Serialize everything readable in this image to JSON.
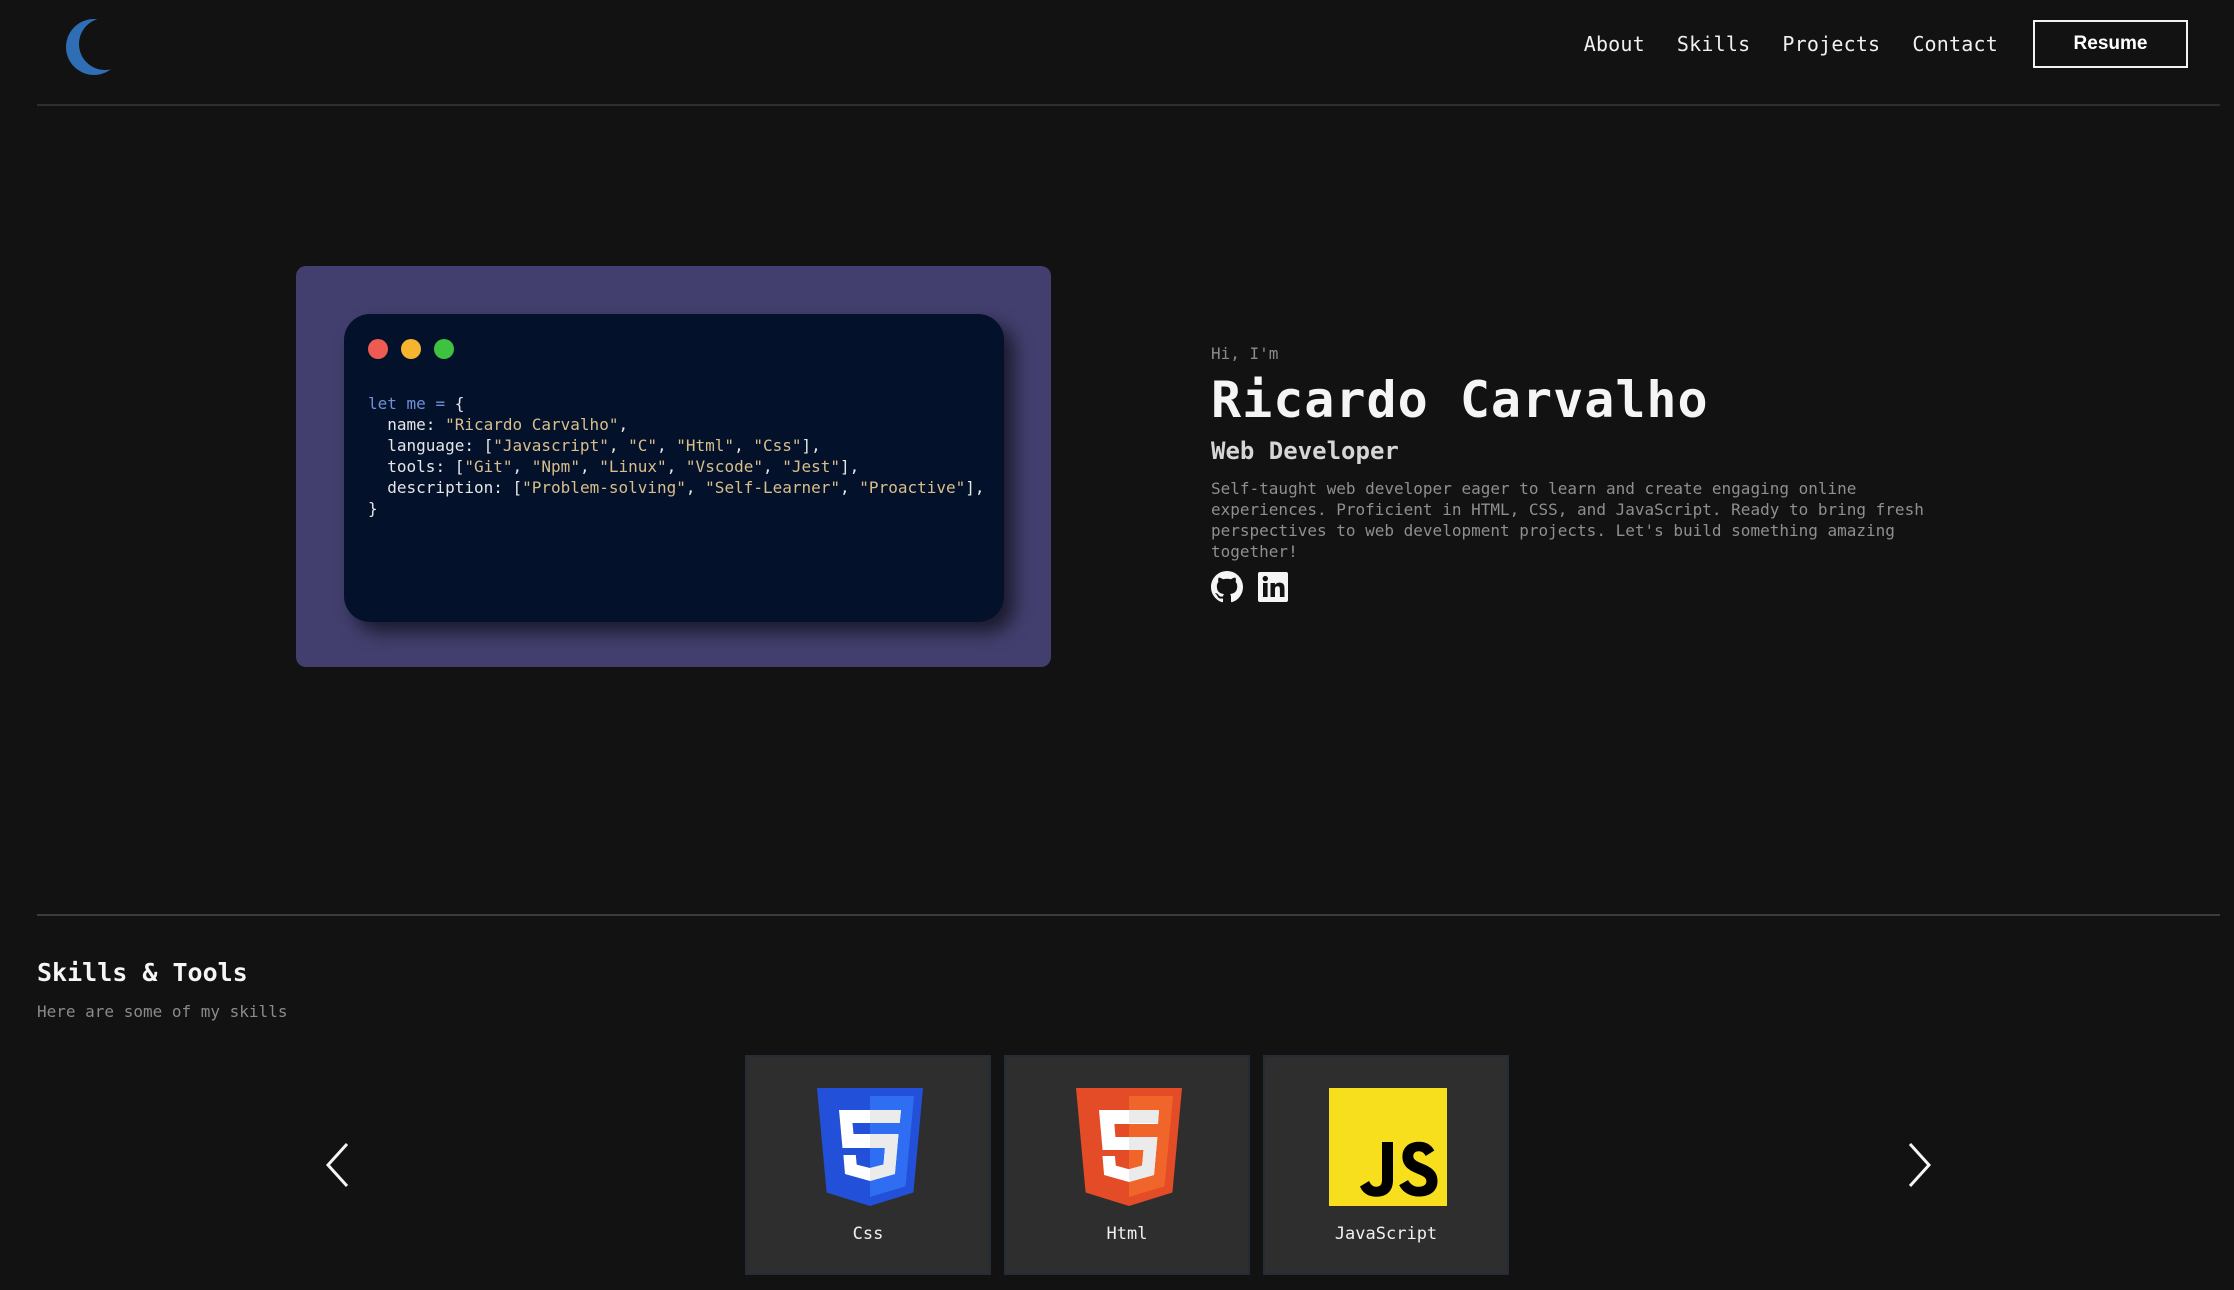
{
  "header": {
    "logo_icon": "crescent-moon-icon",
    "nav": [
      {
        "label": "About"
      },
      {
        "label": "Skills"
      },
      {
        "label": "Projects"
      },
      {
        "label": "Contact"
      }
    ],
    "resume_label": "Resume"
  },
  "hero": {
    "window_dots": [
      "#ee5b52",
      "#f5b52e",
      "#3fc23f"
    ],
    "code": {
      "keyword": "let",
      "var_name": "me",
      "name_key": "name",
      "name_value": "\"Ricardo Carvalho\"",
      "language_key": "language",
      "languages": [
        "\"Javascript\"",
        "\"C\"",
        "\"Html\"",
        "\"Css\""
      ],
      "tools_key": "tools",
      "tools": [
        "\"Git\"",
        "\"Npm\"",
        "\"Linux\"",
        "\"Vscode\"",
        "\"Jest\""
      ],
      "description_key": "description",
      "descriptions": [
        "\"Problem-solving\"",
        "\"Self-Learner\"",
        "\"Proactive\""
      ]
    },
    "greeting": "Hi, I'm",
    "name": "Ricardo Carvalho",
    "role": "Web Developer",
    "bio": "Self-taught web developer eager to learn and create engaging online experiences. Proficient in HTML, CSS, and JavaScript. Ready to bring fresh perspectives to web development projects. Let's build something amazing together!",
    "socials": [
      {
        "icon": "github-icon"
      },
      {
        "icon": "linkedin-icon"
      }
    ]
  },
  "skills": {
    "title": "Skills & Tools",
    "subtitle": "Here are some of my skills",
    "prev_icon": "chevron-left-icon",
    "next_icon": "chevron-right-icon",
    "items": [
      {
        "label": "Css",
        "icon": "css3-icon",
        "color": "#2862e9"
      },
      {
        "label": "Html",
        "icon": "html5-icon",
        "color": "#e44d26"
      },
      {
        "label": "JavaScript",
        "icon": "javascript-icon",
        "color": "#f7df1e"
      }
    ]
  },
  "colors": {
    "background": "#121212",
    "code_frame": "#423f6e",
    "code_window": "#03122a",
    "code_keyword": "#6f8fd8",
    "code_string": "#d9be8b",
    "card": "#2e2e2e"
  }
}
